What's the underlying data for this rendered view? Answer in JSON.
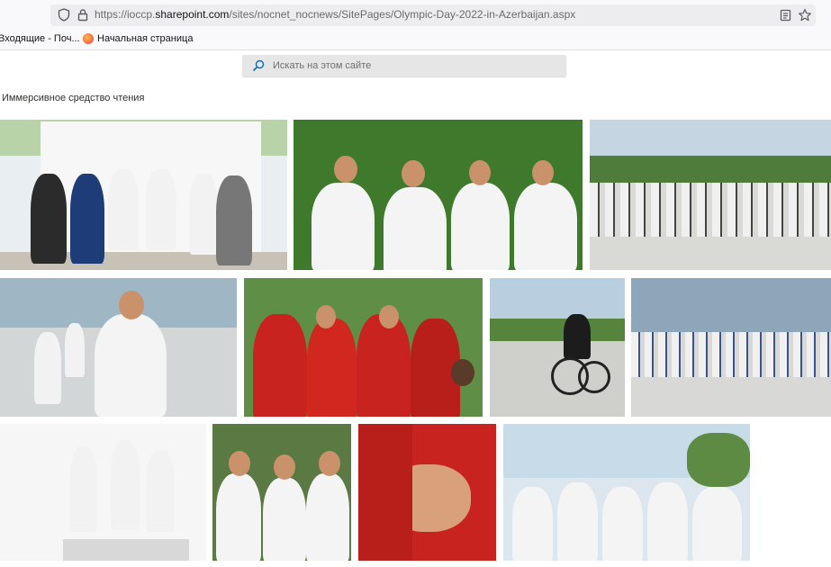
{
  "browser": {
    "url_prefix": "https://ioccp.",
    "url_domain": "sharepoint.com",
    "url_path": "/sites/nocnet_nocnews/SitePages/Olympic-Day-2022-in-Azerbaijan.aspx",
    "bookmarks": [
      {
        "label": "Входящие - Поч..."
      },
      {
        "label": "Начальная страница"
      }
    ]
  },
  "page": {
    "search_placeholder": "Искать на этом сайте",
    "reader_mode_label": "Иммерсивное средство чтения"
  },
  "gallery": {
    "photos": [
      {
        "name": "photo-podium-officials"
      },
      {
        "name": "photo-girls-waving"
      },
      {
        "name": "photo-runners-waterfront"
      },
      {
        "name": "photo-boy-running"
      },
      {
        "name": "photo-red-tracksuits"
      },
      {
        "name": "photo-cyclist"
      },
      {
        "name": "photo-runners-boulevard"
      },
      {
        "name": "photo-podium-kids"
      },
      {
        "name": "photo-boys-group"
      },
      {
        "name": "photo-hands-together"
      },
      {
        "name": "photo-girls-hands-up"
      }
    ]
  },
  "colors": {
    "red_tracksuit": "#c8231f",
    "tshirt": "#f4f4f4",
    "foliage": "#3f7a2c",
    "pavement": "#d9d9d6"
  }
}
